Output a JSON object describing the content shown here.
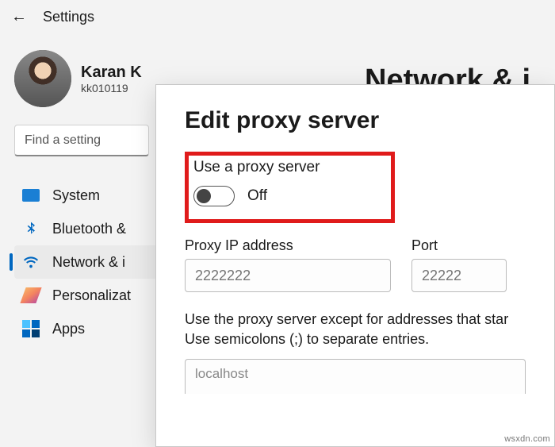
{
  "topbar": {
    "title": "Settings"
  },
  "profile": {
    "name": "Karan K",
    "email": "kk010119"
  },
  "search": {
    "placeholder": "Find a setting"
  },
  "nav": {
    "items": [
      {
        "label": "System"
      },
      {
        "label": "Bluetooth &"
      },
      {
        "label": "Network & i"
      },
      {
        "label": "Personalizat"
      },
      {
        "label": "Apps"
      }
    ],
    "selected_index": 2
  },
  "page": {
    "heading": "Network & i"
  },
  "dialog": {
    "title": "Edit proxy server",
    "proxy_toggle": {
      "label": "Use a proxy server",
      "state": "Off",
      "on": false
    },
    "ip": {
      "label": "Proxy IP address",
      "placeholder": "2222222"
    },
    "port": {
      "label": "Port",
      "placeholder": "22222"
    },
    "desc_line1": "Use the proxy server except for addresses that star",
    "desc_line2": "Use semicolons (;) to separate entries.",
    "bypass": {
      "placeholder": "localhost"
    }
  },
  "watermark": "wsxdn.com"
}
